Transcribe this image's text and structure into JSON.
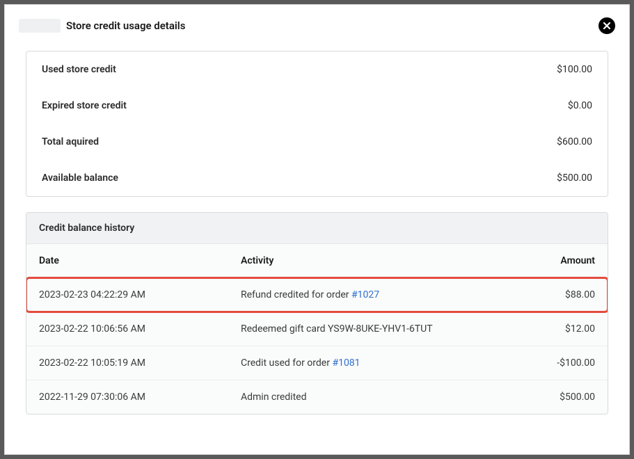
{
  "modal": {
    "title": "Store credit usage details"
  },
  "summary": {
    "used_label": "Used store credit",
    "used_value": "$100.00",
    "expired_label": "Expired store credit",
    "expired_value": "$0.00",
    "acquired_label": "Total aquired",
    "acquired_value": "$600.00",
    "available_label": "Available balance",
    "available_value": "$500.00"
  },
  "history": {
    "section_title": "Credit balance history",
    "columns": {
      "date": "Date",
      "activity": "Activity",
      "amount": "Amount"
    },
    "rows": [
      {
        "date": "2023-02-23 04:22:29 AM",
        "activity_prefix": "Refund credited for order ",
        "activity_link": "#1027",
        "activity_suffix": "",
        "amount": "$88.00",
        "highlighted": true
      },
      {
        "date": "2023-02-22 10:06:56 AM",
        "activity_prefix": "Redeemed gift card YS9W-8UKE-YHV1-6TUT",
        "activity_link": "",
        "activity_suffix": "",
        "amount": "$12.00",
        "highlighted": false
      },
      {
        "date": "2023-02-22 10:05:19 AM",
        "activity_prefix": "Credit used for order ",
        "activity_link": "#1081",
        "activity_suffix": "",
        "amount": "-$100.00",
        "highlighted": false
      },
      {
        "date": "2022-11-29 07:30:06 AM",
        "activity_prefix": "Admin credited",
        "activity_link": "",
        "activity_suffix": "",
        "amount": "$500.00",
        "highlighted": false
      }
    ]
  }
}
